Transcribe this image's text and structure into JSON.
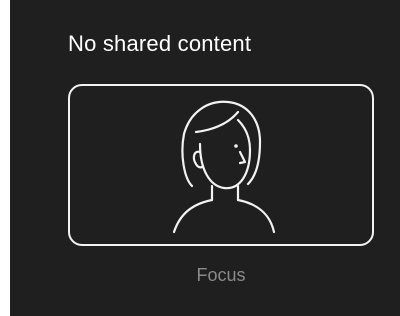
{
  "panel": {
    "title": "No shared content",
    "focus_label": "Focus",
    "icon": "person-icon"
  },
  "colors": {
    "background": "#1f1f1f",
    "title_text": "#ffffff",
    "label_text": "#8a8a8a",
    "outline": "#f2f2f2"
  }
}
